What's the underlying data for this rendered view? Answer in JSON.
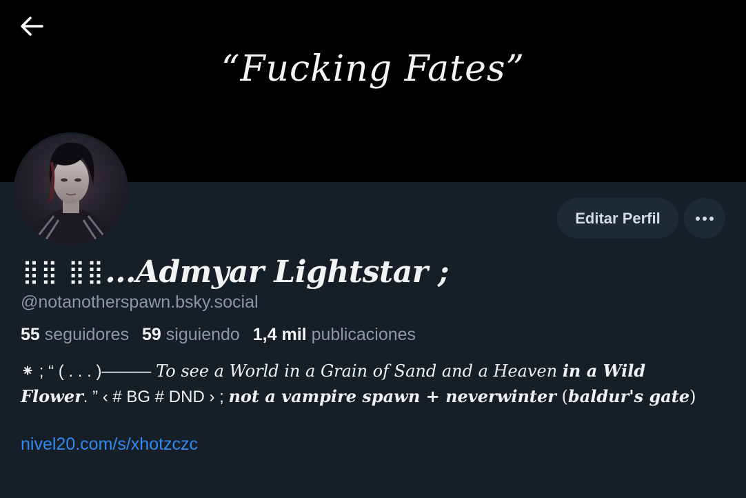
{
  "banner": {
    "back_icon": "arrow-left-icon",
    "text": "“Fucking Fates”",
    "color": "#000000"
  },
  "profile": {
    "display_name_prefix": "⣿⣿ ⣿⣿",
    "display_name": "...Admyar Lightstar ;",
    "handle": "@notanotherspawn.bsky.social",
    "followers_count": "55",
    "followers_label": "seguidores",
    "following_count": "59",
    "following_label": "siguiendo",
    "posts_count": "1,4 mil",
    "posts_label": "publicaciones",
    "bio": {
      "part1": "⁕  ;  “ ( . . . )——— ",
      "part2": "To see a World in a Grain of Sand and a Heaven ",
      "part3": "in a Wild Flower",
      "part4": ". ” ‹ # BG # DND ›  ;  ",
      "part5": "not a vampire spawn + neverwinter",
      "part6": " (",
      "part7": "baldur's gate",
      "part8": ")"
    },
    "link": "nivel20.com/s/xhotzczc"
  },
  "actions": {
    "edit_label": "Editar Perfil",
    "more_icon": "more-horizontal-icon"
  },
  "colors": {
    "background": "#161e27",
    "button_bg": "#1e2936",
    "link": "#2f8af0",
    "muted": "#8a97a5"
  }
}
